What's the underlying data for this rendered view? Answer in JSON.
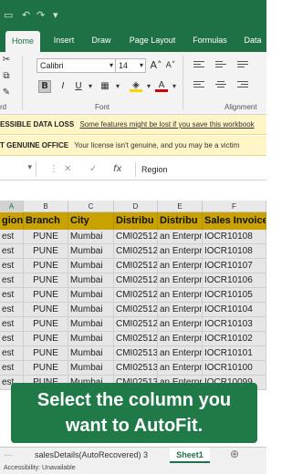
{
  "ribbon_tabs": [
    "Home",
    "Insert",
    "Draw",
    "Page Layout",
    "Formulas",
    "Data"
  ],
  "font": {
    "name": "Calibri",
    "size": "14"
  },
  "ribbon_groups": {
    "font": "Font",
    "alignment": "Alignment",
    "clipboard": "rd"
  },
  "notifications": [
    {
      "tag": "ESSIBLE DATA LOSS",
      "message": "Some features might be lost if you save this workbook"
    },
    {
      "tag": "T GENUINE OFFICE",
      "message": "Your license isn't genuine, and you may be a victim"
    }
  ],
  "formula_bar": {
    "value": "Region",
    "fx": "fx"
  },
  "columns": [
    "A",
    "B",
    "C",
    "D",
    "E",
    "F"
  ],
  "headers": [
    "gion",
    "Branch",
    "City",
    "Distribu",
    "Distribu",
    "Sales Invoice"
  ],
  "rows": [
    [
      "est",
      "PUNE",
      "Mumbai",
      "CMI025127",
      "an Enterpr",
      "IOCR10108"
    ],
    [
      "est",
      "PUNE",
      "Mumbai",
      "CMI025127",
      "an Enterpr",
      "IOCR10108"
    ],
    [
      "est",
      "PUNE",
      "Mumbai",
      "CMI025127",
      "an Enterpr",
      "IOCR10107"
    ],
    [
      "est",
      "PUNE",
      "Mumbai",
      "CMI025127",
      "an Enterpr",
      "IOCR10106"
    ],
    [
      "est",
      "PUNE",
      "Mumbai",
      "CMI025127",
      "an Enterpr",
      "IOCR10105"
    ],
    [
      "est",
      "PUNE",
      "Mumbai",
      "CMI025127",
      "an Enterpr",
      "IOCR10104"
    ],
    [
      "est",
      "PUNE",
      "Mumbai",
      "CMI025127",
      "an Enterpr",
      "IOCR10103"
    ],
    [
      "est",
      "PUNE",
      "Mumbai",
      "CMI025127",
      "an Enterpr",
      "IOCR10102"
    ],
    [
      "est",
      "PUNE",
      "Mumbai",
      "CMI025130",
      "an Enterpr",
      "IOCR10101"
    ],
    [
      "est",
      "PUNE",
      "Mumbai",
      "CMI025130",
      "an Enterpr",
      "IOCR10100"
    ],
    [
      "est",
      "PUNE",
      "Mumbai",
      "CMI025130",
      "an Enterpr",
      "IOCR10099"
    ]
  ],
  "caption": {
    "line1": "Select the column you",
    "line2": "want to AutoFit."
  },
  "sheets": [
    "salesDetails(AutoRecovered) 3",
    "Sheet1"
  ],
  "status": "Accessibility: Unavailable",
  "colors": {
    "excel_green": "#1e7145",
    "header_fill": "#c9a200",
    "caption_bg": "#1f7a47"
  }
}
